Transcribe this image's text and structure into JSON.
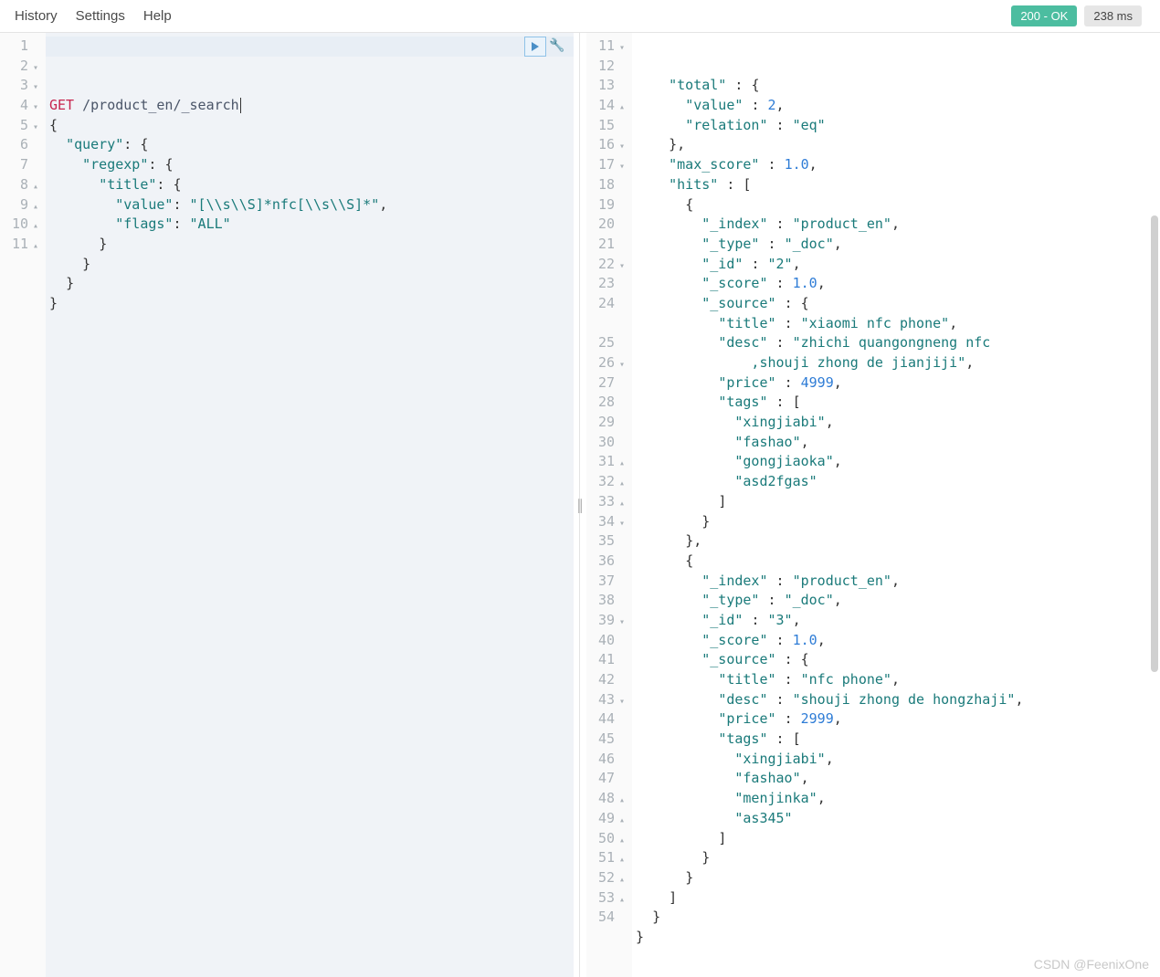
{
  "menu": {
    "items": [
      "History",
      "Settings",
      "Help"
    ]
  },
  "status": {
    "code": "200 - OK",
    "time": "238 ms"
  },
  "request": {
    "lines": [
      {
        "n": 1,
        "fold": "",
        "html": "<span class='tok-method'>GET</span> <span class='tok-path'>/product_en/_search</span>"
      },
      {
        "n": 2,
        "fold": "▾",
        "html": "<span class='tok-brace'>{</span>"
      },
      {
        "n": 3,
        "fold": "▾",
        "html": "  <span class='tok-key'>\"query\"</span><span class='tok-punct'>:</span> <span class='tok-brace'>{</span>"
      },
      {
        "n": 4,
        "fold": "▾",
        "html": "    <span class='tok-key'>\"regexp\"</span><span class='tok-punct'>:</span> <span class='tok-brace'>{</span>"
      },
      {
        "n": 5,
        "fold": "▾",
        "html": "      <span class='tok-key'>\"title\"</span><span class='tok-punct'>:</span> <span class='tok-brace'>{</span>"
      },
      {
        "n": 6,
        "fold": "",
        "html": "        <span class='tok-key'>\"value\"</span><span class='tok-punct'>:</span> <span class='tok-string'>\"[\\\\s\\\\S]*nfc[\\\\s\\\\S]*\"</span><span class='tok-punct'>,</span>"
      },
      {
        "n": 7,
        "fold": "",
        "html": "        <span class='tok-key'>\"flags\"</span><span class='tok-punct'>:</span> <span class='tok-string'>\"ALL\"</span>"
      },
      {
        "n": 8,
        "fold": "▴",
        "html": "      <span class='tok-brace'>}</span>"
      },
      {
        "n": 9,
        "fold": "▴",
        "html": "    <span class='tok-brace'>}</span>"
      },
      {
        "n": 10,
        "fold": "▴",
        "html": "  <span class='tok-brace'>}</span>"
      },
      {
        "n": 11,
        "fold": "▴",
        "html": "<span class='tok-brace'>}</span>"
      }
    ]
  },
  "response": {
    "lines": [
      {
        "n": 11,
        "fold": "▾",
        "html": "    <span class='tok-key'>\"total\"</span> <span class='tok-punct'>:</span> <span class='tok-brace'>{</span>"
      },
      {
        "n": 12,
        "fold": "",
        "html": "      <span class='tok-key'>\"value\"</span> <span class='tok-punct'>:</span> <span class='tok-num'>2</span><span class='tok-punct'>,</span>"
      },
      {
        "n": 13,
        "fold": "",
        "html": "      <span class='tok-key'>\"relation\"</span> <span class='tok-punct'>:</span> <span class='tok-string'>\"eq\"</span>"
      },
      {
        "n": 14,
        "fold": "▴",
        "html": "    <span class='tok-brace'>}</span><span class='tok-punct'>,</span>"
      },
      {
        "n": 15,
        "fold": "",
        "html": "    <span class='tok-key'>\"max_score\"</span> <span class='tok-punct'>:</span> <span class='tok-num'>1.0</span><span class='tok-punct'>,</span>"
      },
      {
        "n": 16,
        "fold": "▾",
        "html": "    <span class='tok-key'>\"hits\"</span> <span class='tok-punct'>:</span> <span class='tok-brace'>[</span>"
      },
      {
        "n": 17,
        "fold": "▾",
        "html": "      <span class='tok-brace'>{</span>"
      },
      {
        "n": 18,
        "fold": "",
        "html": "        <span class='tok-key'>\"_index\"</span> <span class='tok-punct'>:</span> <span class='tok-string'>\"product_en\"</span><span class='tok-punct'>,</span>"
      },
      {
        "n": 19,
        "fold": "",
        "html": "        <span class='tok-key'>\"_type\"</span> <span class='tok-punct'>:</span> <span class='tok-string'>\"_doc\"</span><span class='tok-punct'>,</span>"
      },
      {
        "n": 20,
        "fold": "",
        "html": "        <span class='tok-key'>\"_id\"</span> <span class='tok-punct'>:</span> <span class='tok-string'>\"2\"</span><span class='tok-punct'>,</span>"
      },
      {
        "n": 21,
        "fold": "",
        "html": "        <span class='tok-key'>\"_score\"</span> <span class='tok-punct'>:</span> <span class='tok-num'>1.0</span><span class='tok-punct'>,</span>"
      },
      {
        "n": 22,
        "fold": "▾",
        "html": "        <span class='tok-key'>\"_source\"</span> <span class='tok-punct'>:</span> <span class='tok-brace'>{</span>"
      },
      {
        "n": 23,
        "fold": "",
        "html": "          <span class='tok-key'>\"title\"</span> <span class='tok-punct'>:</span> <span class='tok-string'>\"xiaomi nfc phone\"</span><span class='tok-punct'>,</span>"
      },
      {
        "n": 24,
        "fold": "",
        "html": "          <span class='tok-key'>\"desc\"</span> <span class='tok-punct'>:</span> <span class='tok-string'>\"zhichi quangongneng nfc\n              ,shouji zhong de jianjiji\"</span><span class='tok-punct'>,</span>"
      },
      {
        "n": 25,
        "fold": "",
        "html": "          <span class='tok-key'>\"price\"</span> <span class='tok-punct'>:</span> <span class='tok-num'>4999</span><span class='tok-punct'>,</span>"
      },
      {
        "n": 26,
        "fold": "▾",
        "html": "          <span class='tok-key'>\"tags\"</span> <span class='tok-punct'>:</span> <span class='tok-brace'>[</span>"
      },
      {
        "n": 27,
        "fold": "",
        "html": "            <span class='tok-string'>\"xingjiabi\"</span><span class='tok-punct'>,</span>"
      },
      {
        "n": 28,
        "fold": "",
        "html": "            <span class='tok-string'>\"fashao\"</span><span class='tok-punct'>,</span>"
      },
      {
        "n": 29,
        "fold": "",
        "html": "            <span class='tok-string'>\"gongjiaoka\"</span><span class='tok-punct'>,</span>"
      },
      {
        "n": 30,
        "fold": "",
        "html": "            <span class='tok-string'>\"asd2fgas\"</span>"
      },
      {
        "n": 31,
        "fold": "▴",
        "html": "          <span class='tok-brace'>]</span>"
      },
      {
        "n": 32,
        "fold": "▴",
        "html": "        <span class='tok-brace'>}</span>"
      },
      {
        "n": 33,
        "fold": "▴",
        "html": "      <span class='tok-brace'>}</span><span class='tok-punct'>,</span>"
      },
      {
        "n": 34,
        "fold": "▾",
        "html": "      <span class='tok-brace'>{</span>"
      },
      {
        "n": 35,
        "fold": "",
        "html": "        <span class='tok-key'>\"_index\"</span> <span class='tok-punct'>:</span> <span class='tok-string'>\"product_en\"</span><span class='tok-punct'>,</span>"
      },
      {
        "n": 36,
        "fold": "",
        "html": "        <span class='tok-key'>\"_type\"</span> <span class='tok-punct'>:</span> <span class='tok-string'>\"_doc\"</span><span class='tok-punct'>,</span>"
      },
      {
        "n": 37,
        "fold": "",
        "html": "        <span class='tok-key'>\"_id\"</span> <span class='tok-punct'>:</span> <span class='tok-string'>\"3\"</span><span class='tok-punct'>,</span>"
      },
      {
        "n": 38,
        "fold": "",
        "html": "        <span class='tok-key'>\"_score\"</span> <span class='tok-punct'>:</span> <span class='tok-num'>1.0</span><span class='tok-punct'>,</span>"
      },
      {
        "n": 39,
        "fold": "▾",
        "html": "        <span class='tok-key'>\"_source\"</span> <span class='tok-punct'>:</span> <span class='tok-brace'>{</span>"
      },
      {
        "n": 40,
        "fold": "",
        "html": "          <span class='tok-key'>\"title\"</span> <span class='tok-punct'>:</span> <span class='tok-string'>\"nfc phone\"</span><span class='tok-punct'>,</span>"
      },
      {
        "n": 41,
        "fold": "",
        "html": "          <span class='tok-key'>\"desc\"</span> <span class='tok-punct'>:</span> <span class='tok-string'>\"shouji zhong de hongzhaji\"</span><span class='tok-punct'>,</span>"
      },
      {
        "n": 42,
        "fold": "",
        "html": "          <span class='tok-key'>\"price\"</span> <span class='tok-punct'>:</span> <span class='tok-num'>2999</span><span class='tok-punct'>,</span>"
      },
      {
        "n": 43,
        "fold": "▾",
        "html": "          <span class='tok-key'>\"tags\"</span> <span class='tok-punct'>:</span> <span class='tok-brace'>[</span>"
      },
      {
        "n": 44,
        "fold": "",
        "html": "            <span class='tok-string'>\"xingjiabi\"</span><span class='tok-punct'>,</span>"
      },
      {
        "n": 45,
        "fold": "",
        "html": "            <span class='tok-string'>\"fashao\"</span><span class='tok-punct'>,</span>"
      },
      {
        "n": 46,
        "fold": "",
        "html": "            <span class='tok-string'>\"menjinka\"</span><span class='tok-punct'>,</span>"
      },
      {
        "n": 47,
        "fold": "",
        "html": "            <span class='tok-string'>\"as345\"</span>"
      },
      {
        "n": 48,
        "fold": "▴",
        "html": "          <span class='tok-brace'>]</span>"
      },
      {
        "n": 49,
        "fold": "▴",
        "html": "        <span class='tok-brace'>}</span>"
      },
      {
        "n": 50,
        "fold": "▴",
        "html": "      <span class='tok-brace'>}</span>"
      },
      {
        "n": 51,
        "fold": "▴",
        "html": "    <span class='tok-brace'>]</span>"
      },
      {
        "n": 52,
        "fold": "▴",
        "html": "  <span class='tok-brace'>}</span>"
      },
      {
        "n": 53,
        "fold": "▴",
        "html": "<span class='tok-brace'>}</span>"
      },
      {
        "n": 54,
        "fold": "",
        "html": ""
      }
    ]
  },
  "watermark": "CSDN @FeenixOne"
}
